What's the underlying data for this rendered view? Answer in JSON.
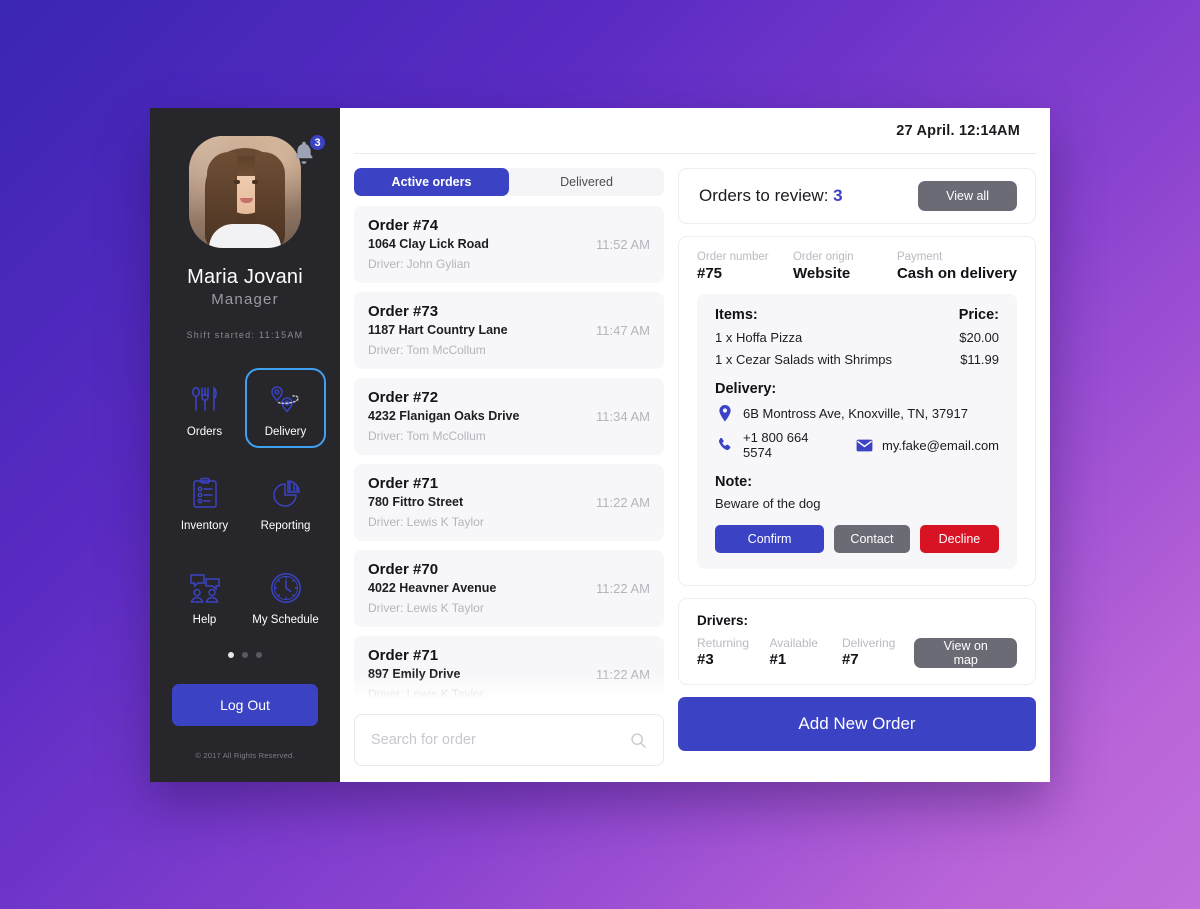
{
  "sidebar": {
    "profile": {
      "name": "Maria Jovani",
      "role": "Manager",
      "shift": "Shift started:   11:15AM",
      "avatar_icon": "user-avatar-photo"
    },
    "notification": {
      "icon": "bell-icon",
      "count": "3"
    },
    "nav": [
      {
        "label": "Orders",
        "icon": "cutlery-icon",
        "active": false
      },
      {
        "label": "Delivery",
        "icon": "route-pin-icon",
        "active": true
      },
      {
        "label": "Inventory",
        "icon": "clipboard-icon",
        "active": false
      },
      {
        "label": "Reporting",
        "icon": "pie-chart-icon",
        "active": false
      },
      {
        "label": "Help",
        "icon": "chat-people-icon",
        "active": false
      },
      {
        "label": "My Schedule",
        "icon": "clock-icon",
        "active": false
      }
    ],
    "pager": {
      "total": 3,
      "active": 0
    },
    "logout_label": "Log Out",
    "copyright": "© 2017 All Rights Reserved."
  },
  "header": {
    "date": "27 April.  12:14AM"
  },
  "orders": {
    "tabs": [
      {
        "label": "Active orders",
        "active": true
      },
      {
        "label": "Delivered",
        "active": false
      }
    ],
    "items": [
      {
        "title": "Order #74",
        "address": "1064 Clay Lick Road",
        "driver": "Driver: John Gylian",
        "time": "11:52 AM"
      },
      {
        "title": "Order #73",
        "address": "1187 Hart Country Lane",
        "driver": "Driver: Tom McCollum",
        "time": "11:47 AM"
      },
      {
        "title": "Order #72",
        "address": "4232 Flanigan Oaks Drive",
        "driver": "Driver: Tom McCollum",
        "time": "11:34 AM"
      },
      {
        "title": "Order #71",
        "address": "780 Fittro Street",
        "driver": "Driver: Lewis K Taylor",
        "time": "11:22 AM"
      },
      {
        "title": "Order #70",
        "address": "4022 Heavner Avenue",
        "driver": "Driver: Lewis K Taylor",
        "time": "11:22 AM"
      },
      {
        "title": "Order #71",
        "address": "897 Emily Drive",
        "driver": "Driver: Lewis K Taylor",
        "time": "11:22 AM"
      }
    ],
    "search": {
      "placeholder": "Search for order",
      "value": "",
      "icon": "search-icon"
    }
  },
  "review": {
    "text_prefix": "Orders to review: ",
    "count": "3",
    "view_all_label": "View all"
  },
  "order_detail": {
    "meta": [
      {
        "label": "Order number",
        "value": "#75"
      },
      {
        "label": "Order origin",
        "value": "Website"
      },
      {
        "label": "Payment",
        "value": "Cash on delivery"
      }
    ],
    "items_header": {
      "items": "Items:",
      "price": "Price:"
    },
    "items": [
      {
        "name": "1 x Hoffa Pizza",
        "price": "$20.00"
      },
      {
        "name": "1 x Cezar Salads with Shrimps",
        "price": "$11.99"
      }
    ],
    "delivery_title": "Delivery:",
    "address": {
      "icon": "map-pin-icon",
      "text": "6B Montross Ave, Knoxville, TN, 37917"
    },
    "phone": {
      "icon": "phone-icon",
      "text": "+1 800 664 5574"
    },
    "email": {
      "icon": "envelope-icon",
      "text": "my.fake@email.com"
    },
    "note_title": "Note:",
    "note_text": "Beware of the dog",
    "actions": [
      {
        "label": "Confirm",
        "role": "confirm"
      },
      {
        "label": "Contact",
        "role": "contact"
      },
      {
        "label": "Decline",
        "role": "decline"
      }
    ]
  },
  "drivers": {
    "title": "Drivers:",
    "stats": [
      {
        "label": "Returning",
        "value": "#3"
      },
      {
        "label": "Available",
        "value": "#1"
      },
      {
        "label": "Delivering",
        "value": "#7"
      }
    ],
    "view_map_label": "View on map"
  },
  "footer": {
    "add_order_label": "Add New Order"
  },
  "colors": {
    "accent": "#3B43C4",
    "danger": "#D81324",
    "neutral": "#6B6B76",
    "sidebar_bg": "#26262B",
    "active_outline": "#3FA0F0",
    "bg_start": "#3A25B4",
    "bg_end": "#C06FDB"
  }
}
